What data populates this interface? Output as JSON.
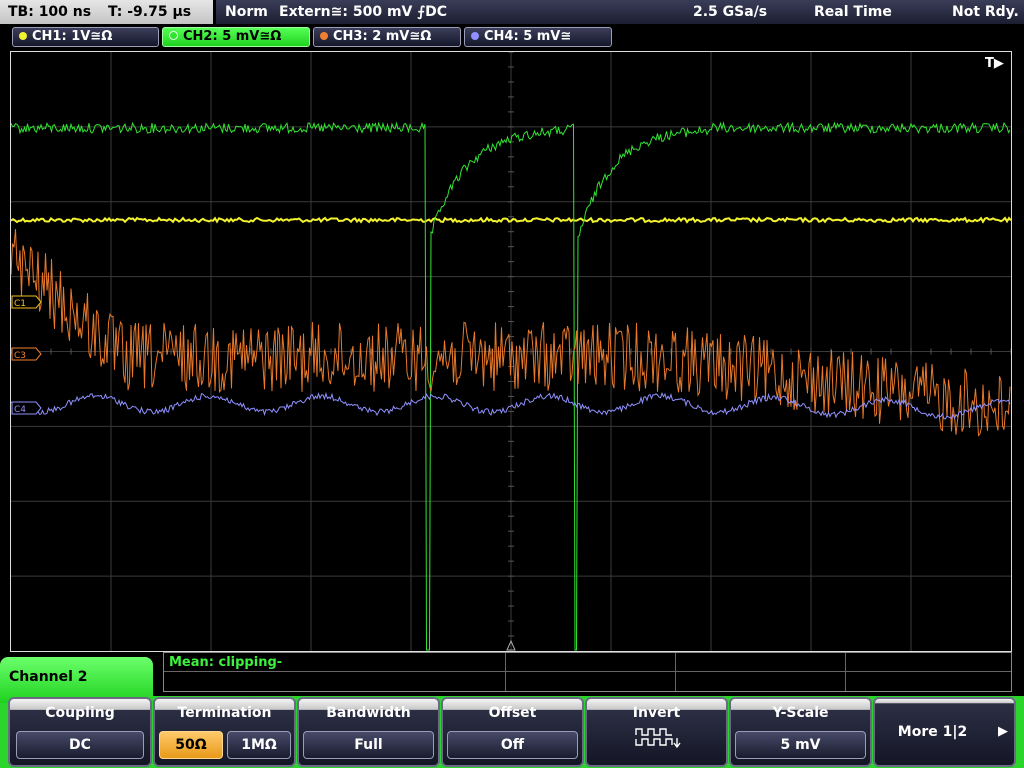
{
  "status": {
    "timebase": "TB: 100 ns",
    "trigger_time": "T: -9.75 µs",
    "trigger_mode": "Norm",
    "trigger_source": "Extern≅: 500 mV ⨍DC",
    "sample_rate": "2.5 GSa/s",
    "acq_mode": "Real Time",
    "state": "Not Rdy."
  },
  "channels": [
    {
      "label": "CH1: 1V≅Ω",
      "color": "#f2f230"
    },
    {
      "label": "CH2: 5 mV≅Ω",
      "color": "#32e432"
    },
    {
      "label": "CH3: 2 mV≅Ω",
      "color": "#f08030"
    },
    {
      "label": "CH4: 5 mV≅",
      "color": "#9090ff"
    }
  ],
  "markers": {
    "trigger": "T▶",
    "ch1": "C1",
    "ch3": "C3",
    "ch4": "C4"
  },
  "measurement": {
    "text": "Mean: clipping-"
  },
  "menu": {
    "title": "Channel 2",
    "coupling": {
      "label": "Coupling",
      "value": "DC"
    },
    "termination": {
      "label": "Termination",
      "options": [
        "50Ω",
        "1MΩ"
      ],
      "selected": "50Ω"
    },
    "bandwidth": {
      "label": "Bandwidth",
      "value": "Full"
    },
    "offset": {
      "label": "Offset",
      "value": "Off"
    },
    "invert": {
      "label": "Invert",
      "icon": "invert-waveform-icon"
    },
    "yscale": {
      "label": "Y-Scale",
      "value": "5 mV"
    },
    "more": {
      "label": "More 1|2",
      "arrow": "▶"
    }
  }
}
